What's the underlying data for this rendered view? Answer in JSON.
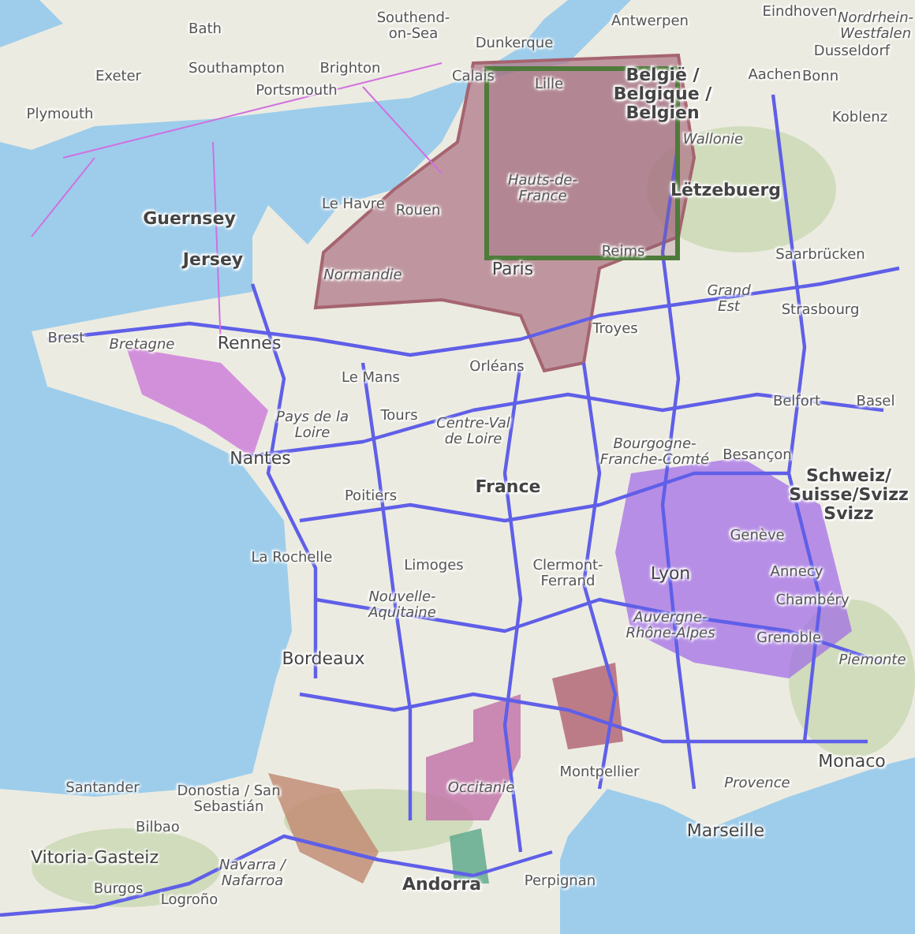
{
  "map": {
    "labels": [
      {
        "text": "Bath",
        "kind": "city"
      },
      {
        "text": "Southend-on-Sea",
        "kind": "city"
      },
      {
        "text": "Exeter",
        "kind": "city"
      },
      {
        "text": "Southampton",
        "kind": "city"
      },
      {
        "text": "Brighton",
        "kind": "city"
      },
      {
        "text": "Portsmouth",
        "kind": "city"
      },
      {
        "text": "Plymouth",
        "kind": "city"
      },
      {
        "text": "Dunkerque",
        "kind": "city"
      },
      {
        "text": "Antwerpen",
        "kind": "city"
      },
      {
        "text": "Eindhoven",
        "kind": "city"
      },
      {
        "text": "Nordrhein-Westfalen",
        "kind": "region"
      },
      {
        "text": "Dusseldorf",
        "kind": "city"
      },
      {
        "text": "Calais",
        "kind": "city"
      },
      {
        "text": "Lille",
        "kind": "city"
      },
      {
        "text": "België / Belgique / Belgien",
        "kind": "country"
      },
      {
        "text": "Aachen",
        "kind": "city"
      },
      {
        "text": "Bonn",
        "kind": "city"
      },
      {
        "text": "Koblenz",
        "kind": "city"
      },
      {
        "text": "Wallonie",
        "kind": "region"
      },
      {
        "text": "Hauts-de-France",
        "kind": "region"
      },
      {
        "text": "Le Havre",
        "kind": "city"
      },
      {
        "text": "Rouen",
        "kind": "city"
      },
      {
        "text": "Guernsey",
        "kind": "country"
      },
      {
        "text": "Jersey",
        "kind": "country"
      },
      {
        "text": "Lëtzebuerg",
        "kind": "country"
      },
      {
        "text": "Normandie",
        "kind": "region"
      },
      {
        "text": "Paris",
        "kind": "capital"
      },
      {
        "text": "Reims",
        "kind": "city"
      },
      {
        "text": "Saarbrücken",
        "kind": "city"
      },
      {
        "text": "Grand Est",
        "kind": "region"
      },
      {
        "text": "Brest",
        "kind": "city"
      },
      {
        "text": "Bretagne",
        "kind": "region"
      },
      {
        "text": "Rennes",
        "kind": "capital"
      },
      {
        "text": "Troyes",
        "kind": "city"
      },
      {
        "text": "Strasbourg",
        "kind": "city"
      },
      {
        "text": "Le Mans",
        "kind": "city"
      },
      {
        "text": "Orléans",
        "kind": "city"
      },
      {
        "text": "Pays de la Loire",
        "kind": "region"
      },
      {
        "text": "Tours",
        "kind": "city"
      },
      {
        "text": "Centre-Val de Loire",
        "kind": "region"
      },
      {
        "text": "Belfort",
        "kind": "city"
      },
      {
        "text": "Basel",
        "kind": "city"
      },
      {
        "text": "Nantes",
        "kind": "capital"
      },
      {
        "text": "Bourgogne-Franche-Comté",
        "kind": "region"
      },
      {
        "text": "Besançon",
        "kind": "city"
      },
      {
        "text": "Poitiers",
        "kind": "city"
      },
      {
        "text": "France",
        "kind": "country"
      },
      {
        "text": "Schweiz/ Suisse/Svizz Svizz",
        "kind": "country"
      },
      {
        "text": "Genève",
        "kind": "city"
      },
      {
        "text": "La Rochelle",
        "kind": "city"
      },
      {
        "text": "Clermont-Ferrand",
        "kind": "city"
      },
      {
        "text": "Lyon",
        "kind": "capital"
      },
      {
        "text": "Annecy",
        "kind": "city"
      },
      {
        "text": "Limoges",
        "kind": "city"
      },
      {
        "text": "Nouvelle-Aquitaine",
        "kind": "region"
      },
      {
        "text": "Auvergne-Rhône-Alpes",
        "kind": "region"
      },
      {
        "text": "Chambéry",
        "kind": "city"
      },
      {
        "text": "Grenoble",
        "kind": "city"
      },
      {
        "text": "Bordeaux",
        "kind": "capital"
      },
      {
        "text": "Piemonte",
        "kind": "region"
      },
      {
        "text": "Occitanie",
        "kind": "region"
      },
      {
        "text": "Montpellier",
        "kind": "city"
      },
      {
        "text": "Provence",
        "kind": "region"
      },
      {
        "text": "Monaco",
        "kind": "capital"
      },
      {
        "text": "Santander",
        "kind": "city"
      },
      {
        "text": "Donostia / San Sebastián",
        "kind": "city"
      },
      {
        "text": "Bilbao",
        "kind": "city"
      },
      {
        "text": "Marseille",
        "kind": "capital"
      },
      {
        "text": "Vitoria-Gasteiz",
        "kind": "capital"
      },
      {
        "text": "Navarra / Nafarroa",
        "kind": "region"
      },
      {
        "text": "Andorra",
        "kind": "country"
      },
      {
        "text": "Perpignan",
        "kind": "city"
      },
      {
        "text": "Burgos",
        "kind": "city"
      },
      {
        "text": "Logroño",
        "kind": "city"
      }
    ]
  }
}
